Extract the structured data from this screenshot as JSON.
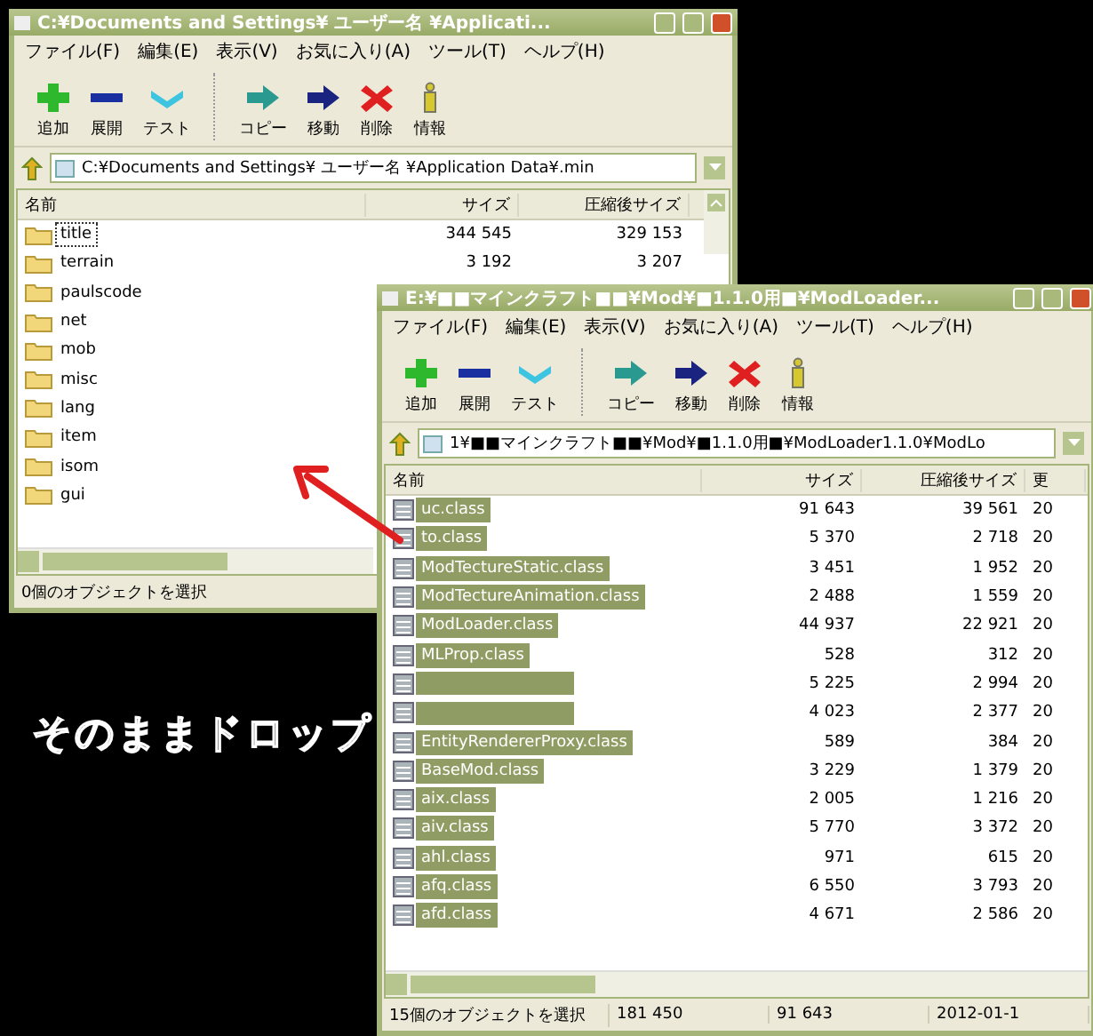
{
  "windows": [
    {
      "title": "C:¥Documents and Settings¥ ユーザー名 ¥Applicati...",
      "menu": [
        "ファイル(F)",
        "編集(E)",
        "表示(V)",
        "お気に入り(A)",
        "ツール(T)",
        "ヘルプ(H)"
      ],
      "toolbar": [
        {
          "label": "追加",
          "kind": "add"
        },
        {
          "label": "展開",
          "kind": "extract"
        },
        {
          "label": "テスト",
          "kind": "test"
        },
        {
          "label": "コピー",
          "kind": "copy"
        },
        {
          "label": "移動",
          "kind": "move"
        },
        {
          "label": "削除",
          "kind": "delete"
        },
        {
          "label": "情報",
          "kind": "info"
        }
      ],
      "path": "C:¥Documents and Settings¥ ユーザー名 ¥Application Data¥.min",
      "columns": [
        "名前",
        "サイズ",
        "圧縮後サイズ"
      ],
      "rows": [
        {
          "kind": "folder",
          "name": "title",
          "size": "344 545",
          "packed": "329 153",
          "selected": false,
          "focused": true
        },
        {
          "kind": "folder",
          "name": "terrain",
          "size": "3 192",
          "packed": "3 207",
          "selected": false,
          "focused": false
        },
        {
          "kind": "folder",
          "name": "paulscode",
          "selected": false,
          "focused": false
        },
        {
          "kind": "folder",
          "name": "net",
          "selected": false,
          "focused": false
        },
        {
          "kind": "folder",
          "name": "mob",
          "selected": false,
          "focused": false
        },
        {
          "kind": "folder",
          "name": "misc",
          "selected": false,
          "focused": false
        },
        {
          "kind": "folder",
          "name": "lang",
          "selected": false,
          "focused": false
        },
        {
          "kind": "folder",
          "name": "item",
          "selected": false,
          "focused": false
        },
        {
          "kind": "folder",
          "name": "isom",
          "selected": false,
          "focused": false
        },
        {
          "kind": "folder",
          "name": "gui",
          "selected": false,
          "focused": false
        }
      ],
      "status": [
        "0個のオブジェクトを選択"
      ]
    },
    {
      "title": "E:¥■■マインクラフト■■¥Mod¥■1.1.0用■¥ModLoader...",
      "menu": [
        "ファイル(F)",
        "編集(E)",
        "表示(V)",
        "お気に入り(A)",
        "ツール(T)",
        "ヘルプ(H)"
      ],
      "toolbar": [
        {
          "label": "追加",
          "kind": "add"
        },
        {
          "label": "展開",
          "kind": "extract"
        },
        {
          "label": "テスト",
          "kind": "test"
        },
        {
          "label": "コピー",
          "kind": "copy"
        },
        {
          "label": "移動",
          "kind": "move"
        },
        {
          "label": "削除",
          "kind": "delete"
        },
        {
          "label": "情報",
          "kind": "info"
        }
      ],
      "path": "1¥■■マインクラフト■■¥Mod¥■1.1.0用■¥ModLoader1.1.0¥ModLo",
      "columns": [
        "名前",
        "サイズ",
        "圧縮後サイズ",
        "更"
      ],
      "rows": [
        {
          "kind": "file",
          "name": "uc.class",
          "size": "91 643",
          "packed": "39 561",
          "modified": "20",
          "selected": true,
          "focused": false
        },
        {
          "kind": "file",
          "name": "to.class",
          "size": "5 370",
          "packed": "2 718",
          "modified": "20",
          "selected": true,
          "focused": false
        },
        {
          "kind": "file",
          "name": "ModTectureStatic.class",
          "size": "3 451",
          "packed": "1 952",
          "modified": "20",
          "selected": true,
          "focused": false
        },
        {
          "kind": "file",
          "name": "ModTectureAnimation.class",
          "size": "2 488",
          "packed": "1 559",
          "modified": "20",
          "selected": true,
          "focused": false
        },
        {
          "kind": "file",
          "name": "ModLoader.class",
          "size": "44 937",
          "packed": "22 921",
          "modified": "20",
          "selected": true,
          "focused": false
        },
        {
          "kind": "file",
          "name": "MLProp.class",
          "size": "528",
          "packed": "312",
          "modified": "20",
          "selected": true,
          "focused": false
        },
        {
          "kind": "file",
          "size": "5 225",
          "packed": "2 994",
          "modified": "20",
          "selected": true,
          "focused": false
        },
        {
          "kind": "file",
          "size": "4 023",
          "packed": "2 377",
          "modified": "20",
          "selected": true,
          "focused": false
        },
        {
          "kind": "file",
          "name": "EntityRendererProxy.class",
          "size": "589",
          "packed": "384",
          "modified": "20",
          "selected": true,
          "focused": false
        },
        {
          "kind": "file",
          "name": "BaseMod.class",
          "size": "3 229",
          "packed": "1 379",
          "modified": "20",
          "selected": true,
          "focused": false
        },
        {
          "kind": "file",
          "name": "aix.class",
          "size": "2 005",
          "packed": "1 216",
          "modified": "20",
          "selected": true,
          "focused": false
        },
        {
          "kind": "file",
          "name": "aiv.class",
          "size": "5 770",
          "packed": "3 372",
          "modified": "20",
          "selected": true,
          "focused": false
        },
        {
          "kind": "file",
          "name": "ahl.class",
          "size": "971",
          "packed": "615",
          "modified": "20",
          "selected": true,
          "focused": false
        },
        {
          "kind": "file",
          "name": "afq.class",
          "size": "6 550",
          "packed": "3 793",
          "modified": "20",
          "selected": true,
          "focused": false
        },
        {
          "kind": "file",
          "name": "afd.class",
          "size": "4 671",
          "packed": "2 586",
          "modified": "20",
          "selected": true,
          "focused": false
        }
      ],
      "status": [
        "15個のオブジェクトを選択",
        "181 450",
        "91 643",
        "2012-01-1"
      ]
    }
  ],
  "annotation": {
    "text": "そのままドロップ"
  }
}
